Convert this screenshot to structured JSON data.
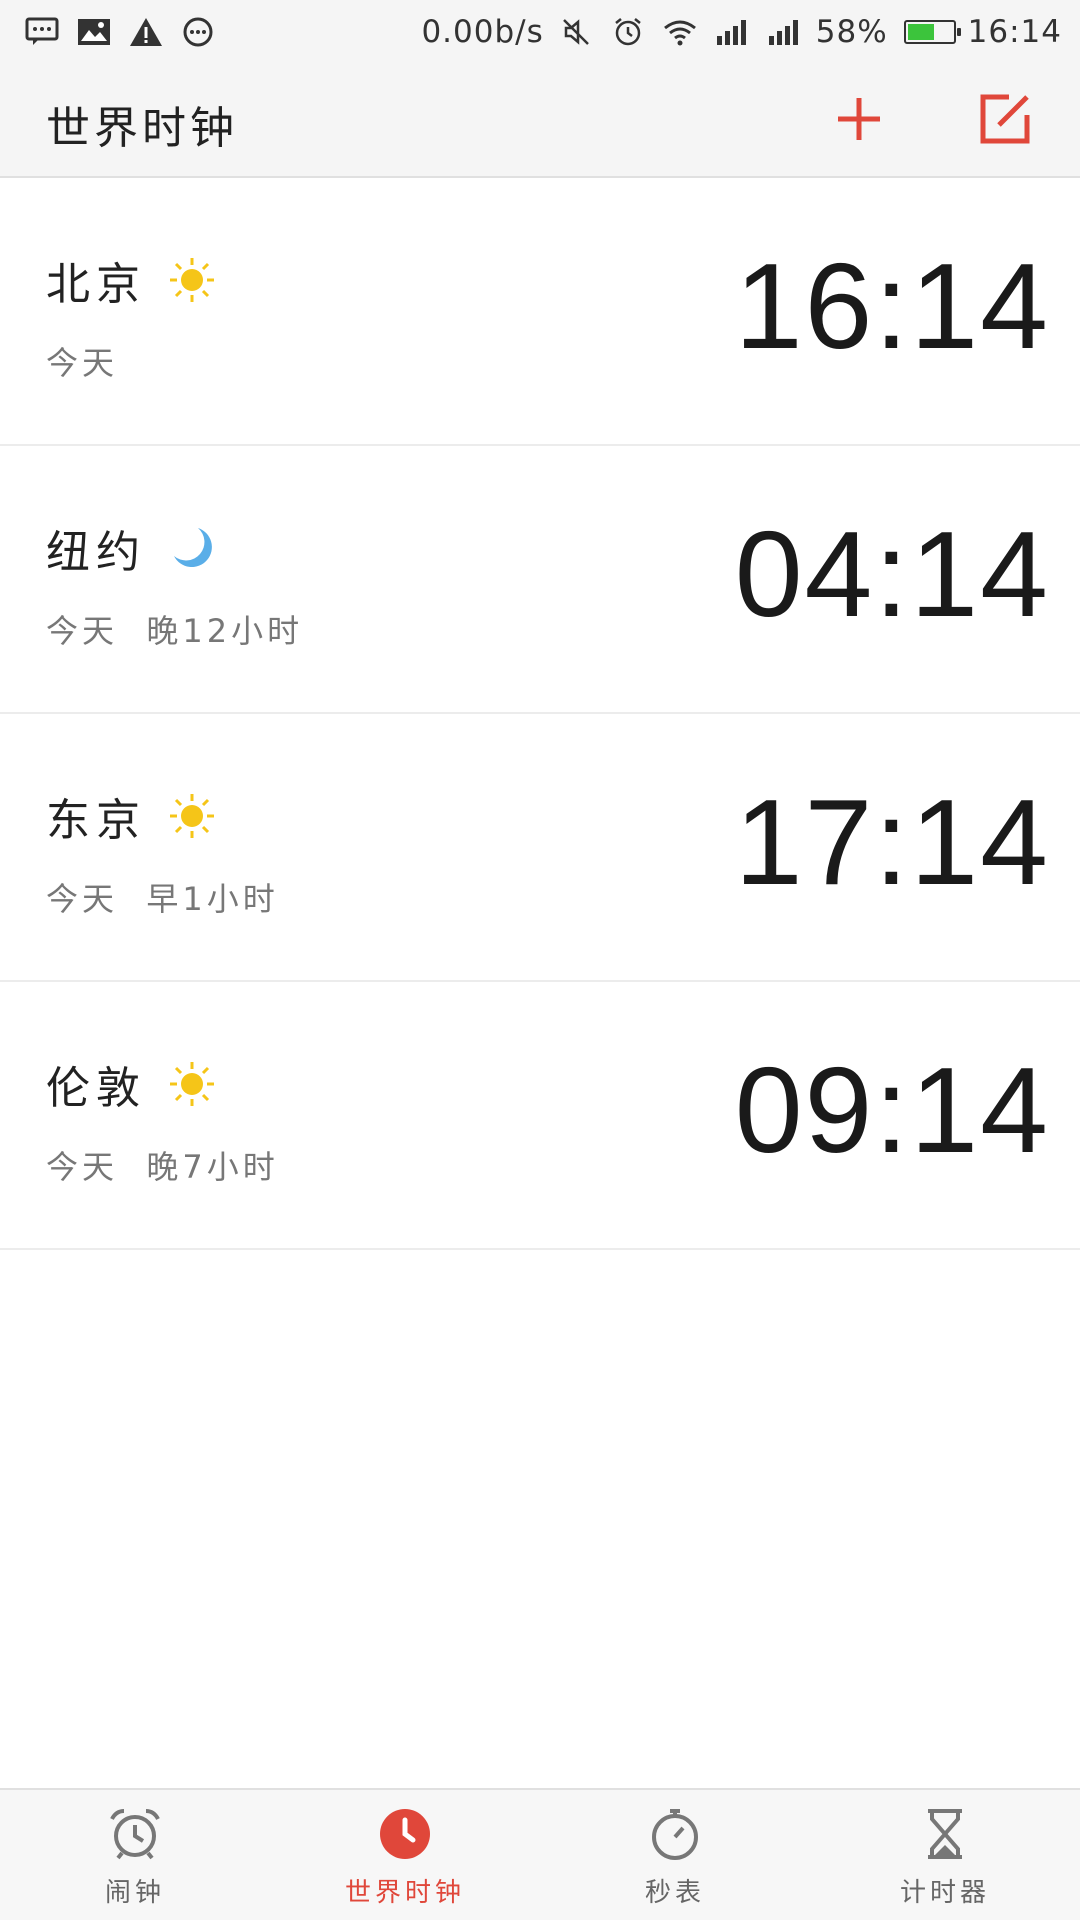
{
  "status_bar": {
    "network_speed": "0.00b/s",
    "battery_percent": "58%",
    "battery_level": 0.58,
    "time": "16:14",
    "left_icons": [
      "message-icon",
      "image-icon",
      "warning-icon",
      "more-icon"
    ],
    "right_icons": [
      "mute-icon",
      "alarm-icon",
      "wifi-icon",
      "signal-icon",
      "signal-icon"
    ]
  },
  "app_bar": {
    "title": "世界时钟",
    "accent_color": "#e0473a",
    "actions": [
      "add-icon",
      "edit-icon"
    ]
  },
  "clocks": [
    {
      "city": "北京",
      "weather": "sun-icon",
      "day": "今天",
      "offset": "",
      "time": "16:14"
    },
    {
      "city": "纽约",
      "weather": "moon-icon",
      "day": "今天",
      "offset": "晚12小时",
      "time": "04:14"
    },
    {
      "city": "东京",
      "weather": "sun-icon",
      "day": "今天",
      "offset": "早1小时",
      "time": "17:14"
    },
    {
      "city": "伦敦",
      "weather": "sun-icon",
      "day": "今天",
      "offset": "晚7小时",
      "time": "09:14"
    }
  ],
  "bottom_nav": {
    "items": [
      {
        "label": "闹钟",
        "icon": "alarm-clock-icon",
        "active": false
      },
      {
        "label": "世界时钟",
        "icon": "clock-icon",
        "active": true
      },
      {
        "label": "秒表",
        "icon": "stopwatch-icon",
        "active": false
      },
      {
        "label": "计时器",
        "icon": "hourglass-icon",
        "active": false
      }
    ]
  }
}
